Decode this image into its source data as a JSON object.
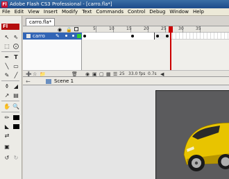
{
  "window": {
    "app_badge": "Fl",
    "title": "Adobe Flash CS3 Professional - [carro.fla*]"
  },
  "menu": [
    "File",
    "Edit",
    "View",
    "Insert",
    "Modify",
    "Text",
    "Commands",
    "Control",
    "Debug",
    "Window",
    "Help"
  ],
  "toolbar": {
    "badge": "Fl",
    "tools": [
      "selection-tool",
      "subselection-tool",
      "free-transform-tool",
      "lasso-tool",
      "pen-tool",
      "text-tool",
      "line-tool",
      "rectangle-tool",
      "pencil-tool",
      "brush-tool",
      "ink-bottle-tool",
      "paint-bucket-tool",
      "eyedropper-tool",
      "eraser-tool",
      "hand-tool",
      "zoom-tool",
      "stroke-color",
      "fill-color"
    ]
  },
  "document": {
    "tab_label": "carro.fla*"
  },
  "timeline": {
    "ruler_numbers": [
      "5",
      "10",
      "15",
      "20",
      "25",
      "30",
      "35"
    ],
    "layer": {
      "name": "carro"
    },
    "current_frame": "25",
    "fps": "33.0 fps",
    "elapsed": "0.7s"
  },
  "editbar": {
    "scene_label": "Scene 1"
  },
  "stage": {
    "background": "#5b5b5d",
    "car_color": "#e8c400"
  }
}
